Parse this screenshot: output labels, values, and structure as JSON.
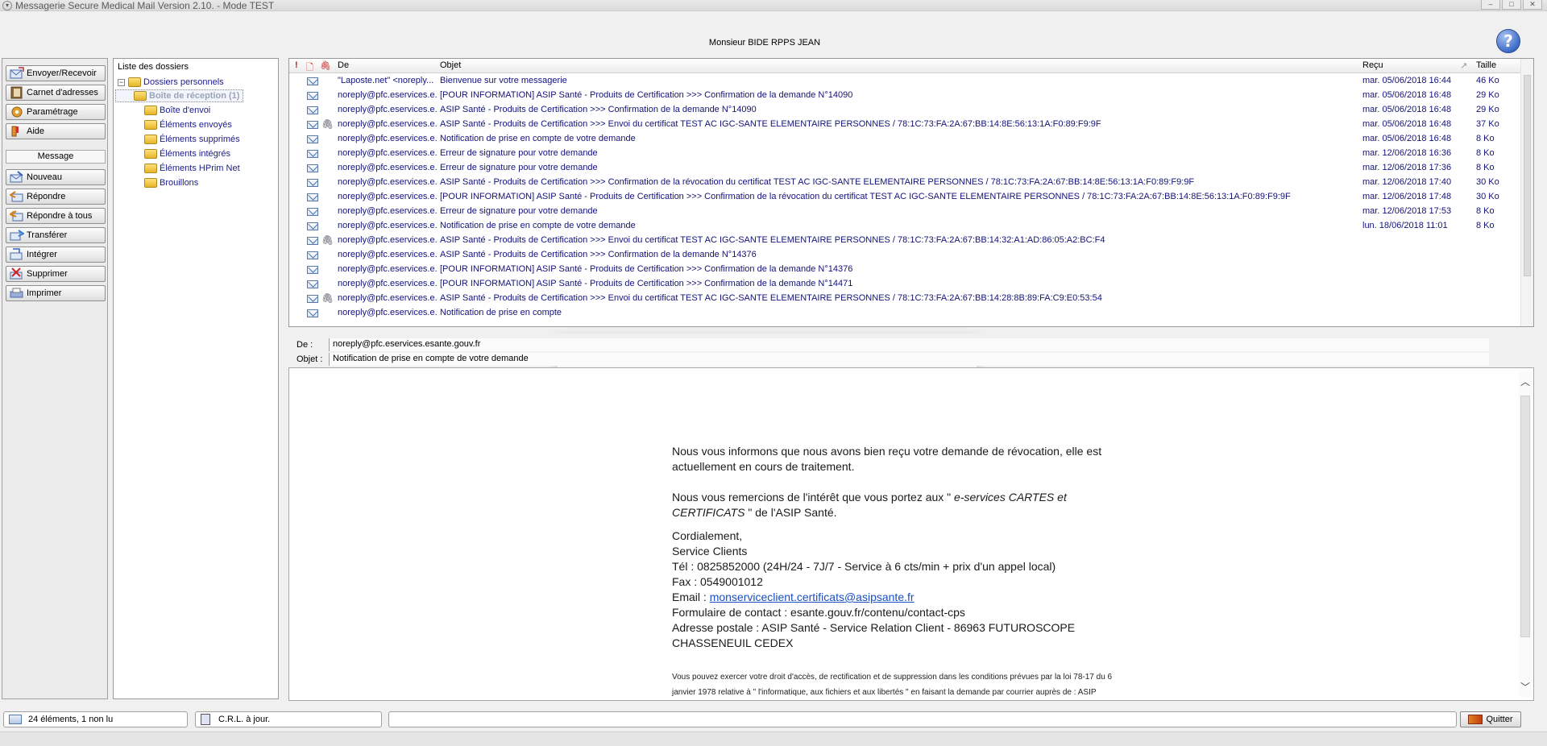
{
  "window": {
    "title": "Messagerie Secure Medical Mail Version 2.10. - Mode TEST",
    "controls": [
      "–",
      "□",
      "✕"
    ]
  },
  "header": {
    "user": "Monsieur BIDE RPPS JEAN",
    "help": "?"
  },
  "sidebar": {
    "buttons": [
      {
        "label": "Envoyer/Recevoir"
      },
      {
        "label": "Carnet d'adresses"
      },
      {
        "label": "Paramétrage"
      },
      {
        "label": "Aide"
      }
    ],
    "section": "Message",
    "message_buttons": [
      {
        "label": "Nouveau"
      },
      {
        "label": "Répondre"
      },
      {
        "label": "Répondre à tous"
      },
      {
        "label": "Transférer"
      },
      {
        "label": "Intégrer"
      },
      {
        "label": "Supprimer"
      },
      {
        "label": "Imprimer"
      }
    ]
  },
  "folders": {
    "title": "Liste des dossiers",
    "root": "Dossiers personnels",
    "expander": "−",
    "items": [
      {
        "label": "Boîte de réception (1)"
      },
      {
        "label": "Boîte d'envoi"
      },
      {
        "label": "Éléments envoyés"
      },
      {
        "label": "Éléments supprimés"
      },
      {
        "label": "Éléments intégrés"
      },
      {
        "label": "Éléments HPrim Net"
      },
      {
        "label": "Brouillons"
      }
    ]
  },
  "message_list": {
    "columns": {
      "flag": "!",
      "doc": "🗋",
      "attach": "🖇",
      "from": "De",
      "subject": "Objet",
      "received": "Reçu",
      "sort_indicator": "↗",
      "size": "Taille"
    },
    "rows": [
      {
        "from": "\"Laposte.net\" <noreply...",
        "subject": "Bienvenue sur votre messagerie",
        "received": "mar. 05/06/2018 16:44",
        "size": "46 Ko",
        "attach": ""
      },
      {
        "from": "noreply@pfc.eservices.e...",
        "subject": "[POUR INFORMATION] ASIP Santé  - Produits de Certification >>> Confirmation de la demande N°14090",
        "received": "mar. 05/06/2018 16:48",
        "size": "29 Ko",
        "attach": ""
      },
      {
        "from": "noreply@pfc.eservices.e...",
        "subject": "ASIP Santé  - Produits de Certification >>> Confirmation de la demande N°14090",
        "received": "mar. 05/06/2018 16:48",
        "size": "29 Ko",
        "attach": ""
      },
      {
        "from": "noreply@pfc.eservices.e...",
        "subject": "ASIP Santé  - Produits de Certification >>> Envoi du certificat TEST AC IGC-SANTE ELEMENTAIRE PERSONNES / 78:1C:73:FA:2A:67:BB:14:8E:56:13:1A:F0:89:F9:9F",
        "received": "mar. 05/06/2018 16:48",
        "size": "37 Ko",
        "attach": "🖇"
      },
      {
        "from": "noreply@pfc.eservices.e...",
        "subject": "Notification de prise en compte de votre demande",
        "received": "mar. 05/06/2018 16:48",
        "size": "8 Ko",
        "attach": ""
      },
      {
        "from": "noreply@pfc.eservices.e...",
        "subject": "Erreur de signature pour votre demande",
        "received": "mar. 12/06/2018 16:36",
        "size": "8 Ko",
        "attach": ""
      },
      {
        "from": "noreply@pfc.eservices.e...",
        "subject": "Erreur de signature pour votre demande",
        "received": "mar. 12/06/2018 17:36",
        "size": "8 Ko",
        "attach": ""
      },
      {
        "from": "noreply@pfc.eservices.e...",
        "subject": "ASIP Santé  - Produits de Certification >>> Confirmation de la révocation du certificat TEST AC IGC-SANTE ELEMENTAIRE PERSONNES / 78:1C:73:FA:2A:67:BB:14:8E:56:13:1A:F0:89:F9:9F",
        "received": "mar. 12/06/2018 17:40",
        "size": "30 Ko",
        "attach": ""
      },
      {
        "from": "noreply@pfc.eservices.e...",
        "subject": "[POUR INFORMATION] ASIP Santé  - Produits de Certification >>> Confirmation de la révocation du certificat TEST AC IGC-SANTE ELEMENTAIRE PERSONNES / 78:1C:73:FA:2A:67:BB:14:8E:56:13:1A:F0:89:F9:9F",
        "received": "mar. 12/06/2018 17:48",
        "size": "30 Ko",
        "attach": ""
      },
      {
        "from": "noreply@pfc.eservices.e...",
        "subject": "Erreur de signature pour votre demande",
        "received": "mar. 12/06/2018 17:53",
        "size": "8 Ko",
        "attach": ""
      },
      {
        "from": "noreply@pfc.eservices.e...",
        "subject": "Notification de prise en compte de votre demande",
        "received": "lun. 18/06/2018 11:01",
        "size": "8 Ko",
        "attach": ""
      },
      {
        "from": "noreply@pfc.eservices.e...",
        "subject": "ASIP Santé  - Produits de Certification >>> Envoi du certificat TEST AC IGC-SANTE ELEMENTAIRE PERSONNES / 78:1C:73:FA:2A:67:BB:14:32:A1:AD:86:05:A2:BC:F4",
        "received": "",
        "size": "",
        "attach": "🖇"
      },
      {
        "from": "noreply@pfc.eservices.e...",
        "subject": "ASIP Santé  - Produits de Certification >>> Confirmation de la demande N°14376",
        "received": "",
        "size": "",
        "attach": ""
      },
      {
        "from": "noreply@pfc.eservices.e...",
        "subject": "[POUR INFORMATION] ASIP Santé  - Produits de Certification >>> Confirmation de la demande N°14376",
        "received": "",
        "size": "",
        "attach": ""
      },
      {
        "from": "noreply@pfc.eservices.e...",
        "subject": "[POUR INFORMATION] ASIP Santé  - Produits de Certification >>> Confirmation de la demande N°14471",
        "received": "",
        "size": "",
        "attach": ""
      },
      {
        "from": "noreply@pfc.eservices.e...",
        "subject": "ASIP Santé  - Produits de Certification >>> Envoi du certificat TEST AC IGC-SANTE ELEMENTAIRE PERSONNES / 78:1C:73:FA:2A:67:BB:14:28:8B:89:FA:C9:E0:53:54",
        "received": "",
        "size": "",
        "attach": "🖇"
      },
      {
        "from": "noreply@pfc.eservices.e...",
        "subject": "Notification de prise en compte",
        "received": "",
        "size": "",
        "attach": ""
      }
    ]
  },
  "preview": {
    "from_label": "De :",
    "from_value": "noreply@pfc.eservices.esante.gouv.fr",
    "subject_label": "Objet :",
    "subject_value": "Notification de prise en compte de votre demande",
    "body": {
      "p1": "Nous vous informons que nous avons bien reçu votre demande de révocation, elle est actuellement en cours de traitement.",
      "p2_pre": "Nous vous remercions de l'intérêt que vous portez aux \"",
      "p2_em": " e-services CARTES et CERTIFICATS ",
      "p2_post": "\" de l'ASIP Santé.",
      "closing": "Cordialement,",
      "service": "Service Clients",
      "tel": "Tél : 0825852000 (24H/24 - 7J/7 - Service à 6 cts/min + prix d'un appel local)",
      "fax": "Fax : 0549001012",
      "email_label": "Email : ",
      "email": "monserviceclient.certificats@asipsante.fr",
      "form": "Formulaire de contact : esante.gouv.fr/contenu/contact-cps",
      "address1": "Adresse postale : ASIP Santé - Service Relation Client - 86963 FUTUROSCOPE",
      "address2": "CHASSENEUIL CEDEX",
      "legal1": "Vous pouvez exercer votre droit d'accès, de rectification et de suppression dans les conditions prévues par la loi 78-17 du 6",
      "legal2": "janvier 1978 relative à \" l'informatique, aux fichiers et aux libertés \" en faisant la demande par courrier auprès de : ASIP"
    }
  },
  "statusbar": {
    "count": "24 éléments, 1 non lu",
    "crl": "C.R.L. à jour.",
    "quit": "Quitter"
  },
  "colors": {
    "link": "#1a4fc2",
    "list_text": "#12127a",
    "help_blue": "#3e6cc7"
  }
}
